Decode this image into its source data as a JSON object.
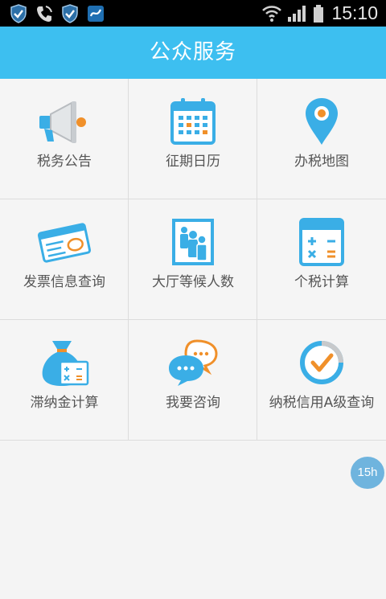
{
  "status_bar": {
    "time": "15:10",
    "icons": [
      "shield-icon",
      "phone-icon",
      "shield-icon",
      "app-icon",
      "wifi-icon",
      "signal-icon",
      "battery-icon"
    ]
  },
  "header": {
    "title": "公众服务"
  },
  "grid": {
    "items": [
      {
        "label": "税务公告",
        "icon": "megaphone-icon"
      },
      {
        "label": "征期日历",
        "icon": "calendar-icon"
      },
      {
        "label": "办税地图",
        "icon": "map-pin-icon"
      },
      {
        "label": "发票信息查询",
        "icon": "invoice-icon"
      },
      {
        "label": "大厅等候人数",
        "icon": "queue-icon"
      },
      {
        "label": "个税计算",
        "icon": "calculator-icon"
      },
      {
        "label": "滞纳金计算",
        "icon": "money-bag-icon"
      },
      {
        "label": "我要咨询",
        "icon": "chat-bubble-icon"
      },
      {
        "label": "纳税信用A级查询",
        "icon": "check-circle-icon"
      }
    ]
  },
  "floating_badge": {
    "text": "15h"
  },
  "colors": {
    "header": "#3dbff0",
    "icon_blue": "#3aaee6",
    "icon_orange": "#f0902a",
    "background": "#f4f4f4"
  }
}
